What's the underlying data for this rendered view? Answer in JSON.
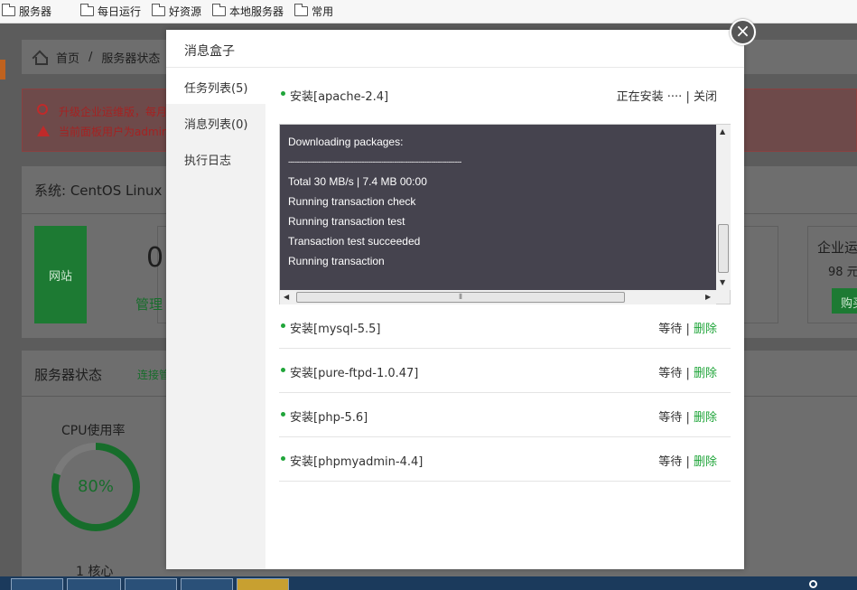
{
  "bookmarks": [
    {
      "label": "服务器"
    },
    {
      "label": "每日运行"
    },
    {
      "label": "好资源"
    },
    {
      "label": "本地服务器"
    },
    {
      "label": "常用"
    }
  ],
  "background": {
    "breadcrumb": {
      "home": "首页",
      "separator": "/",
      "current": "服务器状态"
    },
    "alert": {
      "line1": "升级企业运维版，每月",
      "line2": "当前面板用户为admin"
    },
    "system": {
      "title": "系统: CentOS Linux",
      "site_tile": "网站",
      "site_count": "0",
      "site_manage": "管理"
    },
    "enterprise": {
      "title": "企业运",
      "price": "98 元",
      "button": "购买"
    },
    "status": {
      "title": "服务器状态",
      "link": "连接管",
      "cpu_label": "CPU使用率",
      "cpu_value": "80%",
      "cpu_fraction": 0.8,
      "cores": "1 核心"
    }
  },
  "modal": {
    "title": "消息盒子",
    "close_symbol": "×",
    "sidebar": [
      {
        "label": "任务列表(5)"
      },
      {
        "label": "消息列表(0)"
      },
      {
        "label": "执行日志"
      }
    ],
    "current_task": {
      "name": "安装[apache-2.4]",
      "status": "正在安装 ····",
      "separator": "|",
      "action": "关闭",
      "log": [
        "Downloading packages:",
        "--------------------------------------------------------------------------------",
        "Total 30 MB/s | 7.4 MB 00:00",
        "Running transaction check",
        "Running transaction test",
        "Transaction test succeeded",
        "Running transaction"
      ]
    },
    "tasks": [
      {
        "name": "安装[mysql-5.5]",
        "status": "等待",
        "separator": "|",
        "action": "删除"
      },
      {
        "name": "安装[pure-ftpd-1.0.47]",
        "status": "等待",
        "separator": "|",
        "action": "删除"
      },
      {
        "name": "安装[php-5.6]",
        "status": "等待",
        "separator": "|",
        "action": "删除"
      },
      {
        "name": "安装[phpmyadmin-4.4]",
        "status": "等待",
        "separator": "|",
        "action": "删除"
      }
    ]
  },
  "colors": {
    "accent": "#20a53a",
    "console_bg": "#45434e",
    "overlay": "#5c5c5c"
  }
}
